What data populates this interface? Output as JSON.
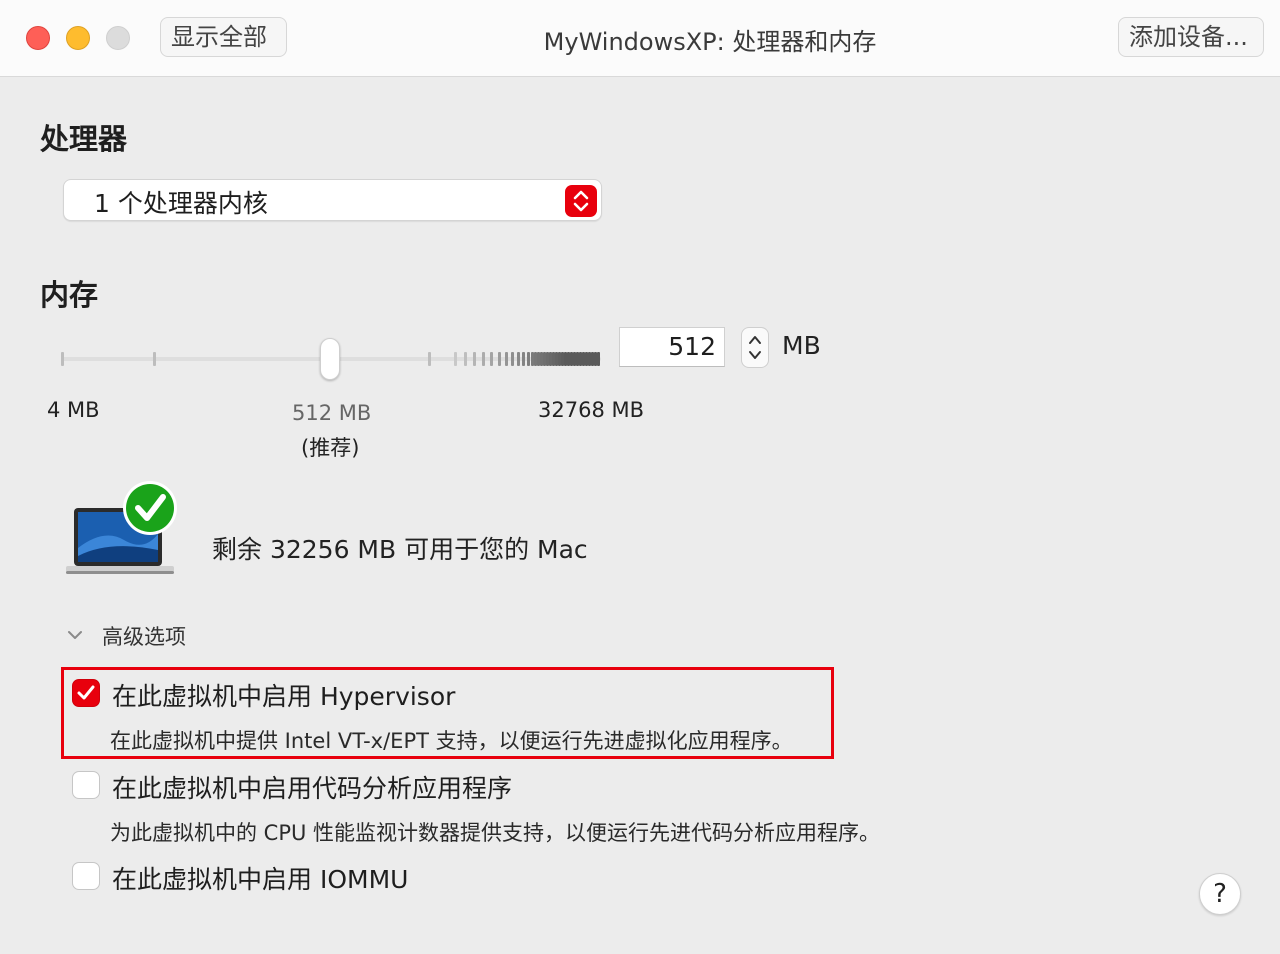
{
  "window": {
    "title": "MyWindowsXP: 处理器和内存",
    "show_all_label": "显示全部",
    "add_device_label": "添加设备..."
  },
  "processor": {
    "heading": "处理器",
    "selected": "1 个处理器内核"
  },
  "memory": {
    "heading": "内存",
    "min_label": "4 MB",
    "recommended_value_label": "512 MB",
    "recommended_tag": "(推荐)",
    "max_label": "32768 MB",
    "value": "512",
    "unit": "MB",
    "slider_value_mb": 512,
    "available_text": "剩余 32256 MB 可用于您的 Mac"
  },
  "advanced": {
    "label": "高级选项",
    "options": [
      {
        "label": "在此虚拟机中启用 Hypervisor",
        "description": "在此虚拟机中提供 Intel VT-x/EPT 支持，以便运行先进虚拟化应用程序。",
        "checked": true
      },
      {
        "label": "在此虚拟机中启用代码分析应用程序",
        "description": "为此虚拟机中的 CPU 性能监视计数器提供支持，以便运行先进代码分析应用程序。",
        "checked": false
      },
      {
        "label": "在此虚拟机中启用 IOMMU",
        "checked": false
      }
    ]
  },
  "help_label": "?",
  "colors": {
    "accent": "#e8000d",
    "background": "#ececec",
    "titlebar": "#fbfbfb",
    "highlight_border": "#e8000d",
    "check_badge": "#1aa31a"
  },
  "icons": [
    "close-icon",
    "minimize-icon",
    "zoom-icon",
    "up-down-arrows-icon",
    "stepper-icon",
    "macbook-icon",
    "checkmark-badge-icon",
    "chevron-down-icon",
    "checkmark-icon",
    "help-icon"
  ]
}
